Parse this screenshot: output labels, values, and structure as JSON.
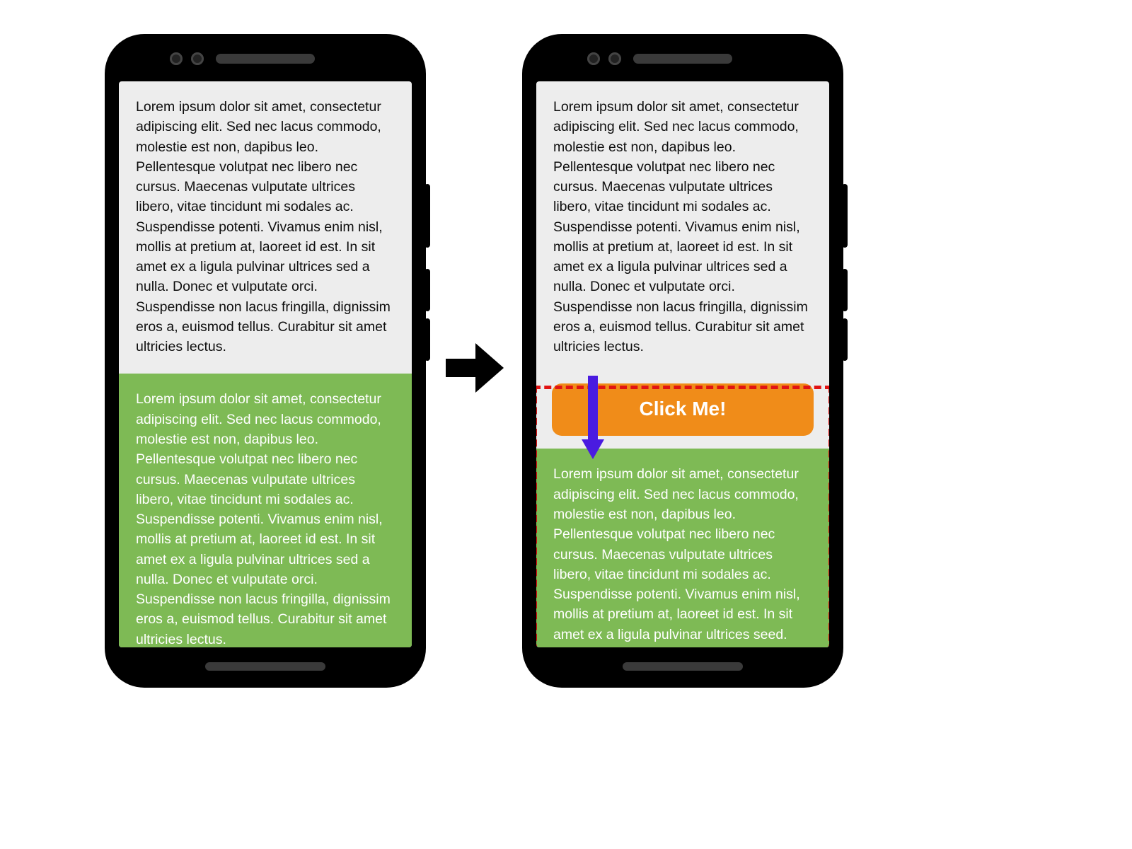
{
  "leftPhone": {
    "topParagraph": "Lorem ipsum dolor sit amet, consectetur adipiscing elit. Sed nec lacus commodo, molestie est non, dapibus leo. Pellentesque volutpat nec libero nec cursus. Maecenas vulputate ultrices libero, vitae tincidunt mi sodales ac. Suspendisse potenti. Vivamus enim nisl, mollis at pretium at, laoreet id est. In sit amet ex a ligula pulvinar ultrices sed a nulla. Donec et vulputate orci. Suspendisse non lacus fringilla, dignissim eros a, euismod tellus. Curabitur sit amet ultricies lectus.",
    "bottomParagraph": "Lorem ipsum dolor sit amet, consectetur adipiscing elit. Sed nec lacus commodo, molestie est non, dapibus leo. Pellentesque volutpat nec libero nec cursus. Maecenas vulputate ultrices libero, vitae tincidunt mi sodales ac. Suspendisse potenti. Vivamus enim nisl, mollis at pretium at, laoreet id est. In sit amet ex a ligula pulvinar ultrices sed a nulla. Donec et vulputate orci. Suspendisse non lacus fringilla, dignissim eros a, euismod tellus. Curabitur sit amet ultricies lectus."
  },
  "rightPhone": {
    "topParagraph": "Lorem ipsum dolor sit amet, consectetur adipiscing elit. Sed nec lacus commodo, molestie est non, dapibus leo. Pellentesque volutpat nec libero nec cursus. Maecenas vulputate ultrices libero, vitae tincidunt mi sodales ac. Suspendisse potenti. Vivamus enim nisl, mollis at pretium at, laoreet id est. In sit amet ex a ligula pulvinar ultrices sed a nulla. Donec et vulputate orci. Suspendisse non lacus fringilla, dignissim eros a, euismod tellus. Curabitur sit amet ultricies lectus.",
    "buttonLabel": "Click Me!",
    "bottomParagraph": "Lorem ipsum dolor sit amet, consectetur adipiscing elit. Sed nec lacus commodo, molestie est non, dapibus leo. Pellentesque volutpat nec libero nec cursus. Maecenas vulputate ultrices libero, vitae tincidunt mi sodales ac. Suspendisse potenti. Vivamus enim nisl, mollis at pretium at, laoreet id est. In sit amet ex a ligula pulvinar ultrices seed."
  },
  "colors": {
    "buttonBg": "#f08c19",
    "greenBg": "#7eba55",
    "dashBorder": "#e11313",
    "indigoArrow": "#4a1be0"
  }
}
